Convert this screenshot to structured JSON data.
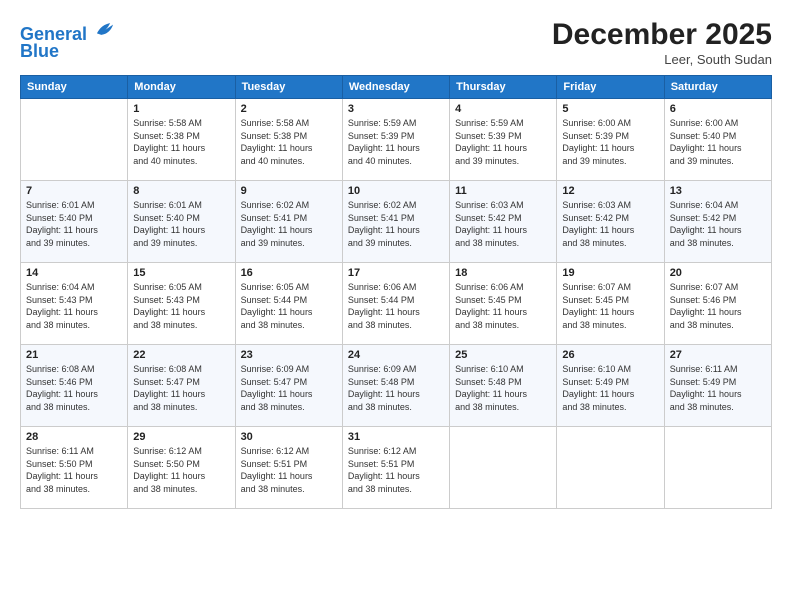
{
  "header": {
    "logo_line1": "General",
    "logo_line2": "Blue",
    "month_title": "December 2025",
    "location": "Leer, South Sudan"
  },
  "days_of_week": [
    "Sunday",
    "Monday",
    "Tuesday",
    "Wednesday",
    "Thursday",
    "Friday",
    "Saturday"
  ],
  "weeks": [
    [
      {
        "day": "",
        "sunrise": "",
        "sunset": "",
        "daylight": ""
      },
      {
        "day": "1",
        "sunrise": "Sunrise: 5:58 AM",
        "sunset": "Sunset: 5:38 PM",
        "daylight": "Daylight: 11 hours and 40 minutes."
      },
      {
        "day": "2",
        "sunrise": "Sunrise: 5:58 AM",
        "sunset": "Sunset: 5:38 PM",
        "daylight": "Daylight: 11 hours and 40 minutes."
      },
      {
        "day": "3",
        "sunrise": "Sunrise: 5:59 AM",
        "sunset": "Sunset: 5:39 PM",
        "daylight": "Daylight: 11 hours and 40 minutes."
      },
      {
        "day": "4",
        "sunrise": "Sunrise: 5:59 AM",
        "sunset": "Sunset: 5:39 PM",
        "daylight": "Daylight: 11 hours and 39 minutes."
      },
      {
        "day": "5",
        "sunrise": "Sunrise: 6:00 AM",
        "sunset": "Sunset: 5:39 PM",
        "daylight": "Daylight: 11 hours and 39 minutes."
      },
      {
        "day": "6",
        "sunrise": "Sunrise: 6:00 AM",
        "sunset": "Sunset: 5:40 PM",
        "daylight": "Daylight: 11 hours and 39 minutes."
      }
    ],
    [
      {
        "day": "7",
        "sunrise": "Sunrise: 6:01 AM",
        "sunset": "Sunset: 5:40 PM",
        "daylight": "Daylight: 11 hours and 39 minutes."
      },
      {
        "day": "8",
        "sunrise": "Sunrise: 6:01 AM",
        "sunset": "Sunset: 5:40 PM",
        "daylight": "Daylight: 11 hours and 39 minutes."
      },
      {
        "day": "9",
        "sunrise": "Sunrise: 6:02 AM",
        "sunset": "Sunset: 5:41 PM",
        "daylight": "Daylight: 11 hours and 39 minutes."
      },
      {
        "day": "10",
        "sunrise": "Sunrise: 6:02 AM",
        "sunset": "Sunset: 5:41 PM",
        "daylight": "Daylight: 11 hours and 39 minutes."
      },
      {
        "day": "11",
        "sunrise": "Sunrise: 6:03 AM",
        "sunset": "Sunset: 5:42 PM",
        "daylight": "Daylight: 11 hours and 38 minutes."
      },
      {
        "day": "12",
        "sunrise": "Sunrise: 6:03 AM",
        "sunset": "Sunset: 5:42 PM",
        "daylight": "Daylight: 11 hours and 38 minutes."
      },
      {
        "day": "13",
        "sunrise": "Sunrise: 6:04 AM",
        "sunset": "Sunset: 5:42 PM",
        "daylight": "Daylight: 11 hours and 38 minutes."
      }
    ],
    [
      {
        "day": "14",
        "sunrise": "Sunrise: 6:04 AM",
        "sunset": "Sunset: 5:43 PM",
        "daylight": "Daylight: 11 hours and 38 minutes."
      },
      {
        "day": "15",
        "sunrise": "Sunrise: 6:05 AM",
        "sunset": "Sunset: 5:43 PM",
        "daylight": "Daylight: 11 hours and 38 minutes."
      },
      {
        "day": "16",
        "sunrise": "Sunrise: 6:05 AM",
        "sunset": "Sunset: 5:44 PM",
        "daylight": "Daylight: 11 hours and 38 minutes."
      },
      {
        "day": "17",
        "sunrise": "Sunrise: 6:06 AM",
        "sunset": "Sunset: 5:44 PM",
        "daylight": "Daylight: 11 hours and 38 minutes."
      },
      {
        "day": "18",
        "sunrise": "Sunrise: 6:06 AM",
        "sunset": "Sunset: 5:45 PM",
        "daylight": "Daylight: 11 hours and 38 minutes."
      },
      {
        "day": "19",
        "sunrise": "Sunrise: 6:07 AM",
        "sunset": "Sunset: 5:45 PM",
        "daylight": "Daylight: 11 hours and 38 minutes."
      },
      {
        "day": "20",
        "sunrise": "Sunrise: 6:07 AM",
        "sunset": "Sunset: 5:46 PM",
        "daylight": "Daylight: 11 hours and 38 minutes."
      }
    ],
    [
      {
        "day": "21",
        "sunrise": "Sunrise: 6:08 AM",
        "sunset": "Sunset: 5:46 PM",
        "daylight": "Daylight: 11 hours and 38 minutes."
      },
      {
        "day": "22",
        "sunrise": "Sunrise: 6:08 AM",
        "sunset": "Sunset: 5:47 PM",
        "daylight": "Daylight: 11 hours and 38 minutes."
      },
      {
        "day": "23",
        "sunrise": "Sunrise: 6:09 AM",
        "sunset": "Sunset: 5:47 PM",
        "daylight": "Daylight: 11 hours and 38 minutes."
      },
      {
        "day": "24",
        "sunrise": "Sunrise: 6:09 AM",
        "sunset": "Sunset: 5:48 PM",
        "daylight": "Daylight: 11 hours and 38 minutes."
      },
      {
        "day": "25",
        "sunrise": "Sunrise: 6:10 AM",
        "sunset": "Sunset: 5:48 PM",
        "daylight": "Daylight: 11 hours and 38 minutes."
      },
      {
        "day": "26",
        "sunrise": "Sunrise: 6:10 AM",
        "sunset": "Sunset: 5:49 PM",
        "daylight": "Daylight: 11 hours and 38 minutes."
      },
      {
        "day": "27",
        "sunrise": "Sunrise: 6:11 AM",
        "sunset": "Sunset: 5:49 PM",
        "daylight": "Daylight: 11 hours and 38 minutes."
      }
    ],
    [
      {
        "day": "28",
        "sunrise": "Sunrise: 6:11 AM",
        "sunset": "Sunset: 5:50 PM",
        "daylight": "Daylight: 11 hours and 38 minutes."
      },
      {
        "day": "29",
        "sunrise": "Sunrise: 6:12 AM",
        "sunset": "Sunset: 5:50 PM",
        "daylight": "Daylight: 11 hours and 38 minutes."
      },
      {
        "day": "30",
        "sunrise": "Sunrise: 6:12 AM",
        "sunset": "Sunset: 5:51 PM",
        "daylight": "Daylight: 11 hours and 38 minutes."
      },
      {
        "day": "31",
        "sunrise": "Sunrise: 6:12 AM",
        "sunset": "Sunset: 5:51 PM",
        "daylight": "Daylight: 11 hours and 38 minutes."
      },
      {
        "day": "",
        "sunrise": "",
        "sunset": "",
        "daylight": ""
      },
      {
        "day": "",
        "sunrise": "",
        "sunset": "",
        "daylight": ""
      },
      {
        "day": "",
        "sunrise": "",
        "sunset": "",
        "daylight": ""
      }
    ]
  ]
}
